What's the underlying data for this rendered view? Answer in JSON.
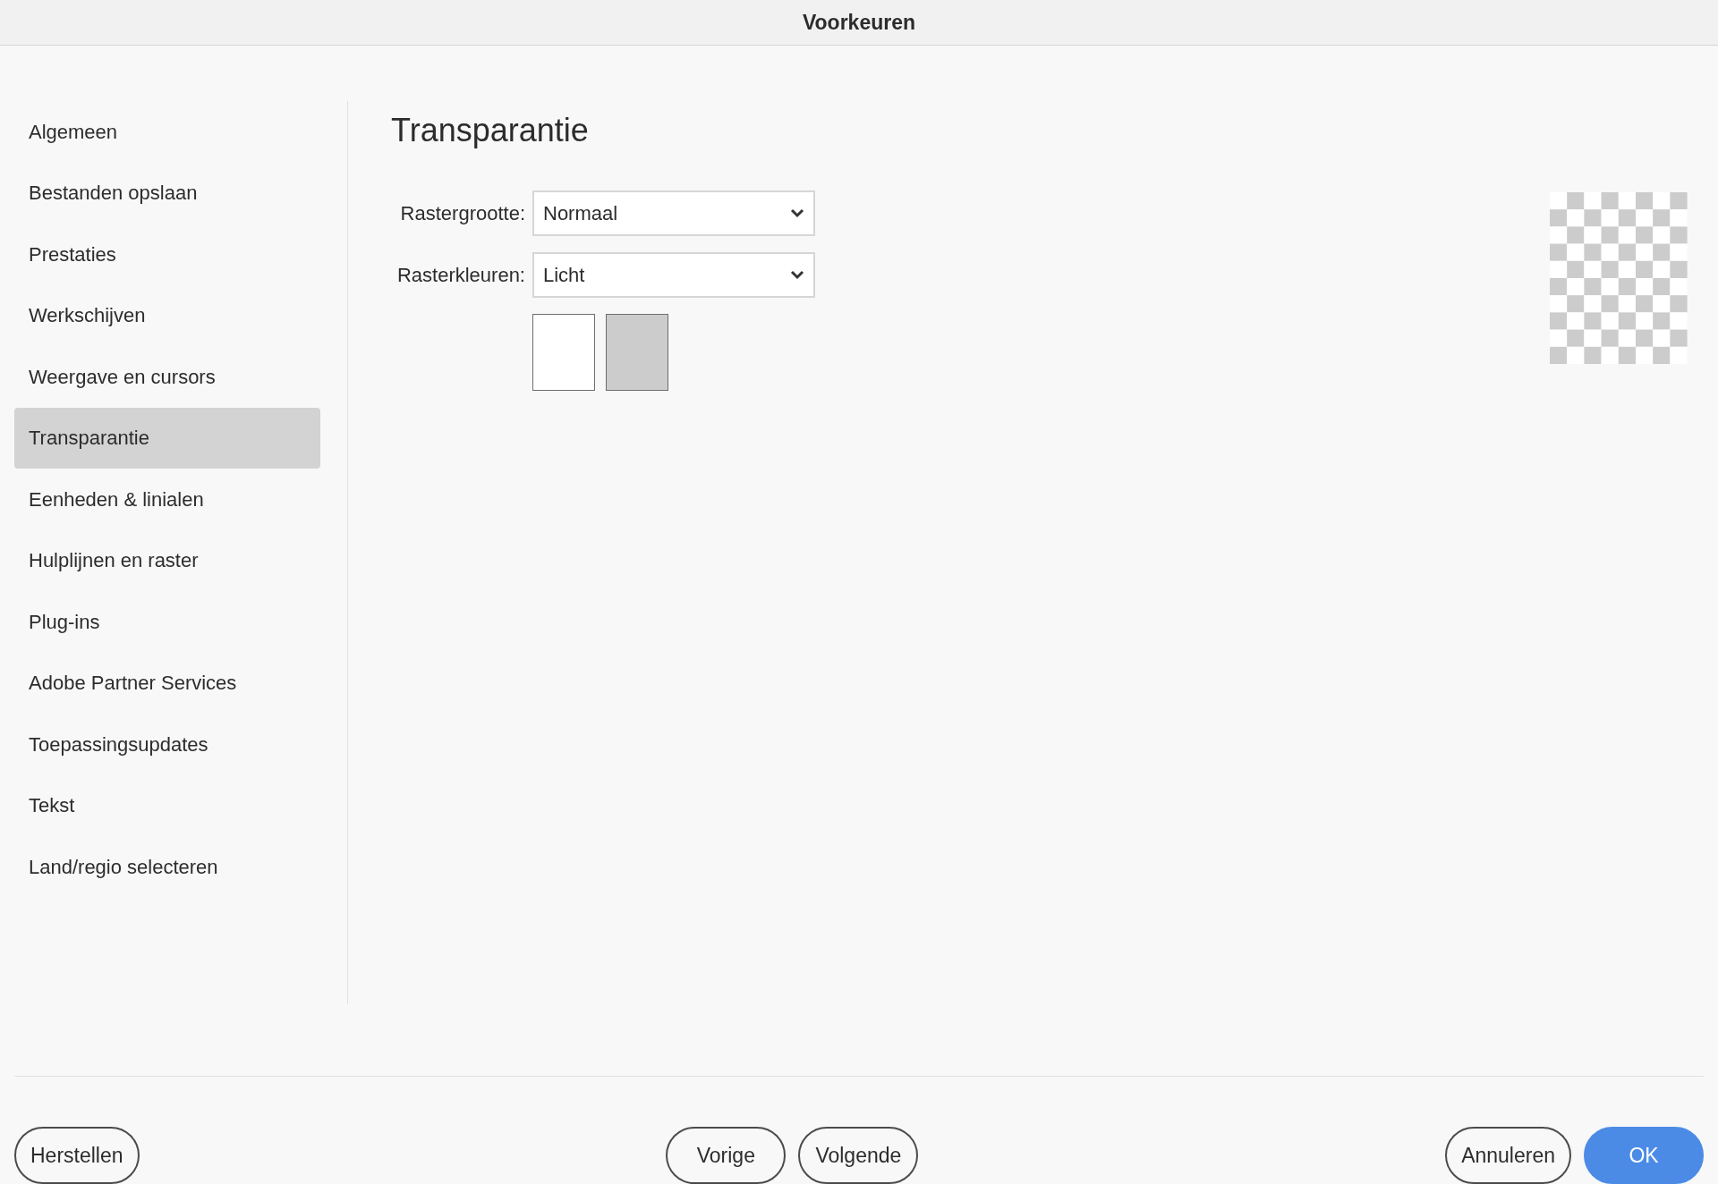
{
  "window": {
    "title": "Voorkeuren"
  },
  "sidebar": {
    "items": [
      {
        "label": "Algemeen",
        "selected": false
      },
      {
        "label": "Bestanden opslaan",
        "selected": false
      },
      {
        "label": "Prestaties",
        "selected": false
      },
      {
        "label": "Werkschijven",
        "selected": false
      },
      {
        "label": "Weergave en cursors",
        "selected": false
      },
      {
        "label": "Transparantie",
        "selected": true
      },
      {
        "label": "Eenheden & linialen",
        "selected": false
      },
      {
        "label": "Hulplijnen en raster",
        "selected": false
      },
      {
        "label": "Plug-ins",
        "selected": false
      },
      {
        "label": "Adobe Partner Services",
        "selected": false
      },
      {
        "label": "Toepassingsupdates",
        "selected": false
      },
      {
        "label": "Tekst",
        "selected": false
      },
      {
        "label": "Land/regio selecteren",
        "selected": false
      }
    ]
  },
  "panel": {
    "heading": "Transparantie",
    "fields": [
      {
        "label": "Rastergrootte:",
        "value": "Normaal"
      },
      {
        "label": "Rasterkleuren:",
        "value": "Licht"
      }
    ],
    "swatches": [
      {
        "color": "#ffffff"
      },
      {
        "color": "#cccccc"
      }
    ]
  },
  "buttons": {
    "left": [
      {
        "label": "Herstellen",
        "kind": "default"
      }
    ],
    "center": [
      {
        "label": "Vorige",
        "kind": "default"
      },
      {
        "label": "Volgende",
        "kind": "default"
      }
    ],
    "right": [
      {
        "label": "Annuleren",
        "kind": "default"
      },
      {
        "label": "OK",
        "kind": "primary"
      }
    ]
  }
}
